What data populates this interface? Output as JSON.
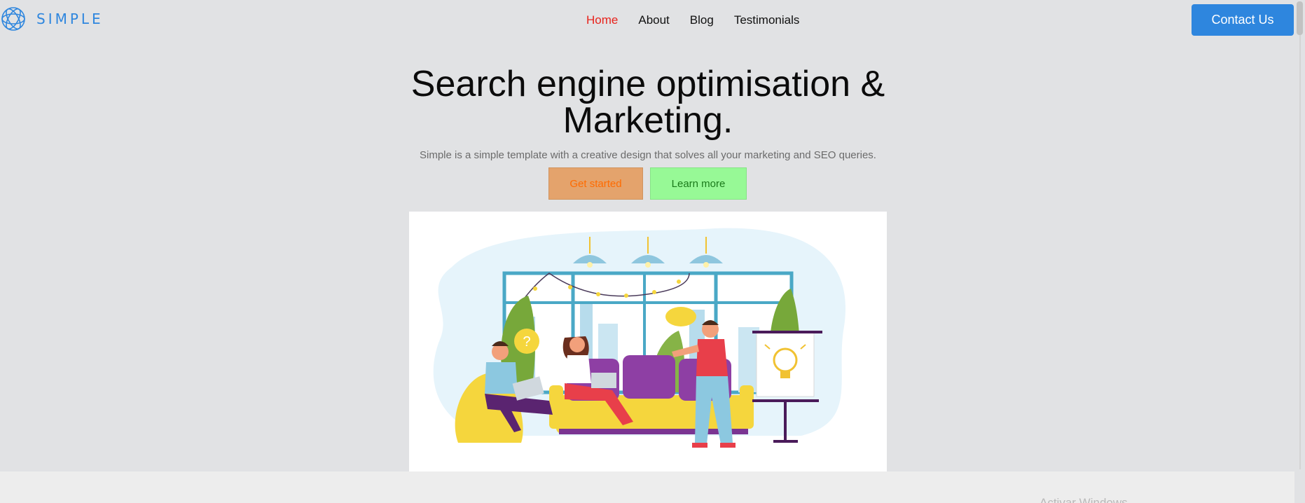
{
  "logo": {
    "text": "SIMPLE",
    "icon": "logo-knot-icon",
    "color": "#2e86de"
  },
  "nav": {
    "items": [
      {
        "label": "Home",
        "active": true
      },
      {
        "label": "About",
        "active": false
      },
      {
        "label": "Blog",
        "active": false
      },
      {
        "label": "Testimonials",
        "active": false
      }
    ]
  },
  "header": {
    "contact_label": "Contact Us"
  },
  "hero": {
    "title_line1": "Search engine optimisation &",
    "title_line2": "Marketing.",
    "subtitle": "Simple is a simple template with a creative design that solves all your marketing and SEO queries.",
    "get_started_label": "Get started",
    "learn_more_label": "Learn more"
  },
  "illustration": {
    "bubble_question": "?"
  },
  "watermark": {
    "text": "Activar Windows"
  },
  "colors": {
    "accent": "#2e86de",
    "nav_active": "#e8231c",
    "get_started_bg": "#e4a36c",
    "learn_more_bg": "#97f996",
    "page_bg": "#e1e2e4"
  }
}
